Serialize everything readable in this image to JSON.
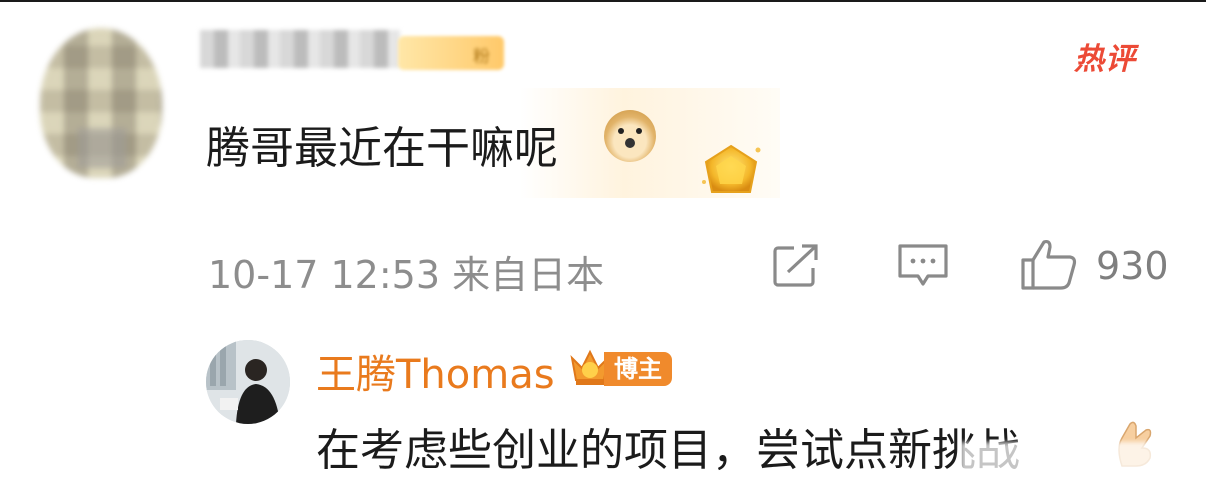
{
  "comment": {
    "fan_badge_label": "粉",
    "hot_tag": "热评",
    "text": "腾哥最近在干嘛呢",
    "time_location": "10-17 12:53 来自日本",
    "like_count": "930"
  },
  "reply": {
    "author": "王腾Thomas",
    "badge": "博主",
    "text": "在考虑些创业的项目，尝试点新挑战"
  },
  "icons": {
    "share": "share-icon",
    "comment": "comment-icon",
    "like": "thumbs-up-icon",
    "emoji": "doge-emoji-icon",
    "gem": "gold-gem-sticker",
    "crown": "crown-icon",
    "hand": "hand-emoji-icon"
  },
  "colors": {
    "hot_tag": "#ec4a36",
    "author_name": "#e97a1d",
    "badge_bg": "#f08a2c",
    "meta_text": "#8d8d8d"
  }
}
